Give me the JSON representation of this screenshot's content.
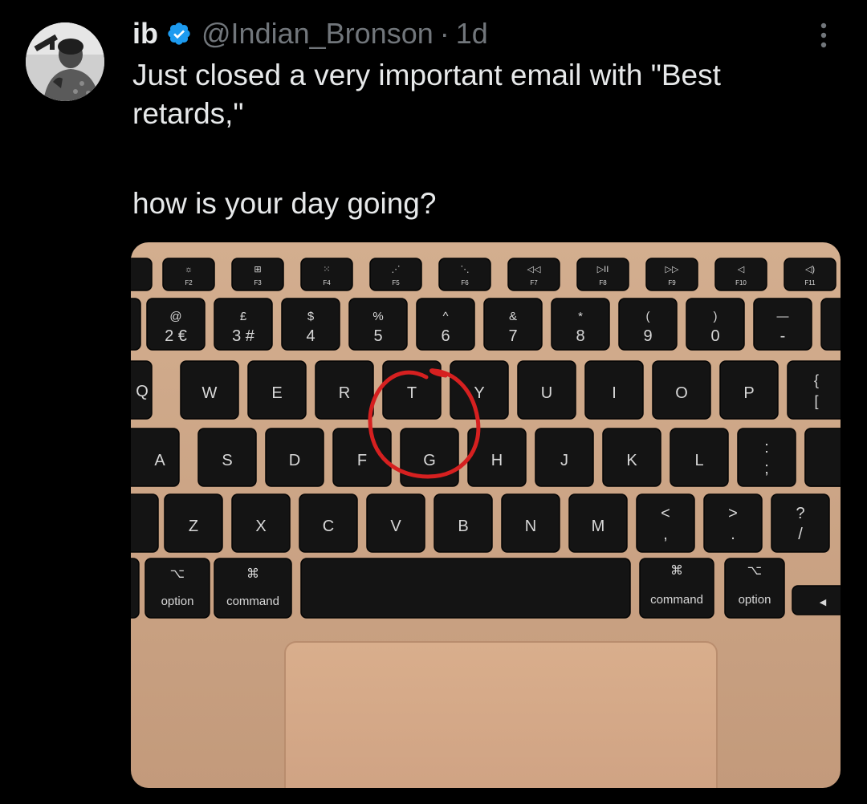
{
  "author": {
    "name": "ib",
    "handle": "@Indian_Bronson",
    "separator": "·",
    "time": "1d",
    "verified": true
  },
  "tweet": {
    "line1": "Just closed a very important email with \"Best retards,\"",
    "line2": "how is your day going?"
  },
  "icons": {
    "verified": "verified-badge-icon",
    "more": "more-options-icon"
  },
  "colors": {
    "verified": "#1d9bf0",
    "secondary_text": "#71767b",
    "circle_annotation": "#d62020"
  },
  "keyboard": {
    "fn_row": [
      {
        "glyph": "☼",
        "label": "F2"
      },
      {
        "glyph": "⊞",
        "label": "F3"
      },
      {
        "glyph": "⁙",
        "label": "F4"
      },
      {
        "glyph": "⋰",
        "label": "F5"
      },
      {
        "glyph": "⋱",
        "label": "F6"
      },
      {
        "glyph": "◁◁",
        "label": "F7"
      },
      {
        "glyph": "▷II",
        "label": "F8"
      },
      {
        "glyph": "▷▷",
        "label": "F9"
      },
      {
        "glyph": "◁",
        "label": "F10"
      },
      {
        "glyph": "◁)",
        "label": "F11"
      }
    ],
    "number_row": [
      {
        "top": "@",
        "bottom": "2 €"
      },
      {
        "top": "£",
        "bottom": "3 #"
      },
      {
        "top": "$",
        "bottom": "4"
      },
      {
        "top": "%",
        "bottom": "5"
      },
      {
        "top": "^",
        "bottom": "6"
      },
      {
        "top": "&",
        "bottom": "7"
      },
      {
        "top": "*",
        "bottom": "8"
      },
      {
        "top": "(",
        "bottom": "9"
      },
      {
        "top": ")",
        "bottom": "0"
      },
      {
        "top": "—",
        "bottom": "-"
      }
    ],
    "qwerty_row": [
      "Q",
      "W",
      "E",
      "R",
      "T",
      "Y",
      "U",
      "I",
      "O",
      "P",
      "{ ["
    ],
    "home_row": [
      "A",
      "S",
      "D",
      "F",
      "G",
      "H",
      "J",
      "K",
      "L",
      ": ;",
      "\""
    ],
    "bottom_row": [
      "Z",
      "X",
      "C",
      "V",
      "B",
      "N",
      "M",
      "< ,",
      "> .",
      "? /"
    ],
    "mod_left": [
      {
        "symbol": "⌥",
        "label": "option"
      },
      {
        "symbol": "⌘",
        "label": "command"
      }
    ],
    "mod_right": [
      {
        "symbol": "⌘",
        "label": "command"
      },
      {
        "symbol": "⌥",
        "label": "option"
      }
    ],
    "arrow_left": "◀"
  }
}
